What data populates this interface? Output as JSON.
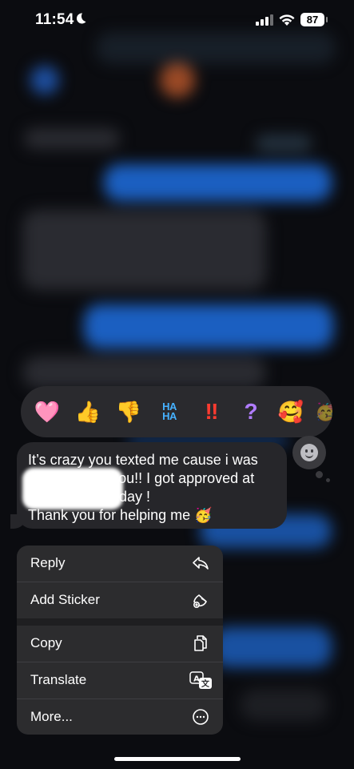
{
  "status_bar": {
    "time": "11:54",
    "battery": "87"
  },
  "tapbacks": [
    {
      "name": "heart-reaction",
      "glyph": "🩷"
    },
    {
      "name": "thumbs-up-reaction",
      "glyph": "👍"
    },
    {
      "name": "thumbs-down-reaction",
      "glyph": "👎"
    },
    {
      "name": "haha-reaction",
      "glyph": "HA\nHA"
    },
    {
      "name": "exclamation-reaction",
      "glyph": "‼"
    },
    {
      "name": "question-reaction",
      "glyph": "?"
    },
    {
      "name": "smiling-hearts-reaction",
      "glyph": "🥰"
    }
  ],
  "message": {
    "text": "It’s crazy you texted me cause i was\nabout to text you!! I got approved at\n!! I move in Friday !\nThank you for helping me 🥳"
  },
  "menu": {
    "items": [
      {
        "label": "Reply",
        "icon": "reply-icon"
      },
      {
        "label": "Add Sticker",
        "icon": "sticker-icon"
      },
      {
        "label": "Copy",
        "icon": "copy-icon"
      },
      {
        "label": "Translate",
        "icon": "translate-icon"
      },
      {
        "label": "More...",
        "icon": "more-icon"
      }
    ]
  },
  "colors": {
    "accent": "#1f6fe0",
    "menu_bg": "#2c2c2e",
    "bubble_bg": "#26262a"
  }
}
